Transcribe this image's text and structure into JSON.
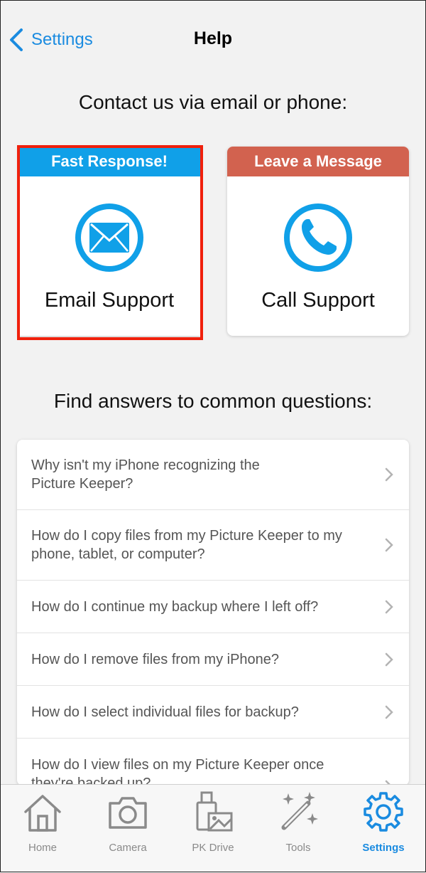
{
  "nav": {
    "back_label": "Settings",
    "title": "Help"
  },
  "contact_heading": "Contact us via email or phone:",
  "email_card": {
    "banner": "Fast Response!",
    "label": "Email Support"
  },
  "call_card": {
    "banner": "Leave a Message",
    "label": "Call Support"
  },
  "faq_heading": "Find answers to common questions:",
  "faq": [
    "Why isn't my iPhone recognizing the Picture Keeper?",
    "How do I copy files from my Picture Keeper to my phone, tablet, or computer?",
    "How do I continue my backup where I left off?",
    "How do I remove files from my iPhone?",
    "How do I select individual files for backup?",
    "How do I view files on my Picture Keeper once they're backed up?"
  ],
  "tabs": [
    {
      "label": "Home",
      "icon": "home-icon"
    },
    {
      "label": "Camera",
      "icon": "camera-icon"
    },
    {
      "label": "PK Drive",
      "icon": "pk-drive-icon"
    },
    {
      "label": "Tools",
      "icon": "magic-wand-icon"
    },
    {
      "label": "Settings",
      "icon": "gear-icon",
      "active": true
    }
  ],
  "colors": {
    "accent": "#1a8be0",
    "email_banner": "#10a0e8",
    "call_banner": "#d2624f",
    "highlight": "#f0200c"
  }
}
